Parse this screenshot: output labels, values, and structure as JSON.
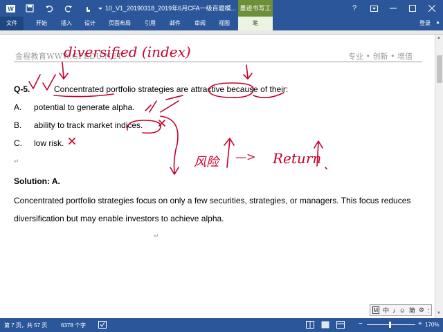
{
  "titlebar": {
    "document_title": "10_V1_20190318_2019年6月CFA一级百题模...",
    "contextual_tools": "墨迹书写工具",
    "icons": [
      "word-icon",
      "save-icon",
      "undo-icon",
      "redo-icon",
      "touch-mode-icon",
      "customize-icon"
    ],
    "window_buttons": [
      "?",
      "ribbon-display-icon",
      "minimize-icon",
      "maximize-icon",
      "close-icon"
    ]
  },
  "ribbon": {
    "tabs": [
      "文件",
      "开始",
      "插入",
      "设计",
      "页面布局",
      "引用",
      "邮件",
      "审阅",
      "视图",
      "笔"
    ],
    "active_tab": "笔",
    "login": "登录"
  },
  "header": {
    "left": "金程教育WWW.GFEDU.NET",
    "right": "专业 • 创新 • 增值"
  },
  "question": {
    "number": "Q-5.",
    "stem": "Concentrated portfolio strategies are attractive because of their:",
    "options": [
      {
        "letter": "A.",
        "text": "potential to generate alpha."
      },
      {
        "letter": "B.",
        "text": "ability to track market indices."
      },
      {
        "letter": "C.",
        "text": "low risk."
      }
    ]
  },
  "solution": {
    "title": "Solution: A.",
    "body": "Concentrated portfolio strategies focus on only a few securities, strategies, or managers. This focus reduces diversification but may enable investors to achieve alpha."
  },
  "ink": {
    "top_note": "diversified (index)",
    "side_note_cn": "风险",
    "side_note_en": "Return",
    "arrow": "—>",
    "color": "#c4002a"
  },
  "ime": {
    "items": [
      "M",
      "中",
      "♪",
      "☺",
      "简",
      "⚙",
      ":"
    ]
  },
  "statusbar": {
    "page": "第 7 页，共 57 页",
    "words": "6378 个字",
    "zoom": "170%",
    "zoom_minus": "−",
    "zoom_plus": "+"
  },
  "colors": {
    "accent": "#2b579a",
    "ink": "#c4002a",
    "header_text": "#9a9a9a"
  }
}
